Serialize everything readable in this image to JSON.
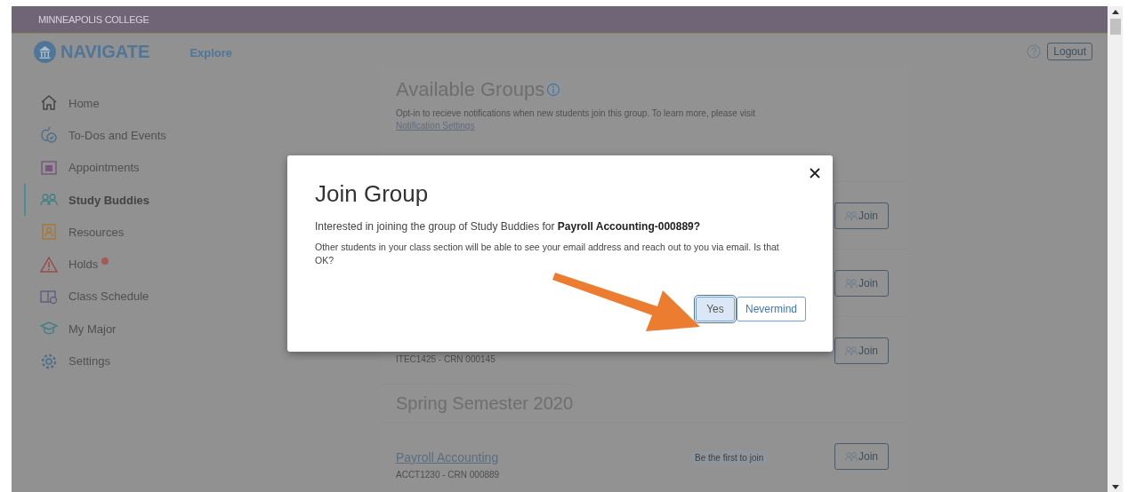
{
  "top_bar": {
    "college": "MINNEAPOLIS COLLEGE"
  },
  "header": {
    "brand": "NAVIGATE",
    "nav": [
      "Explore"
    ],
    "logout": "Logout"
  },
  "sidebar": {
    "items": [
      {
        "label": "Home",
        "selected": false,
        "alert": false
      },
      {
        "label": "To-Dos and Events",
        "selected": false,
        "alert": false
      },
      {
        "label": "Appointments",
        "selected": false,
        "alert": false
      },
      {
        "label": "Study Buddies",
        "selected": true,
        "alert": false
      },
      {
        "label": "Resources",
        "selected": false,
        "alert": false
      },
      {
        "label": "Holds",
        "selected": false,
        "alert": true
      },
      {
        "label": "Class Schedule",
        "selected": false,
        "alert": false
      },
      {
        "label": "My Major",
        "selected": false,
        "alert": false
      },
      {
        "label": "Settings",
        "selected": false,
        "alert": false
      }
    ]
  },
  "main": {
    "title": "Available Groups",
    "description": "Opt-in to recieve notifications when new students join this group. To learn more, please visit",
    "settings_link": "Notification Settings",
    "sections": [
      {
        "groups": [
          {
            "join": "Join"
          },
          {
            "join": "Join"
          },
          {
            "code": "ITEC1425 - CRN 000145",
            "join": "Join"
          }
        ]
      },
      {
        "heading": "Spring Semester 2020",
        "groups": [
          {
            "title": "Payroll Accounting",
            "code": "ACCT1230 - CRN 000889",
            "badge": "Be the first to join",
            "join": "Join"
          }
        ]
      }
    ]
  },
  "dialog": {
    "title": "Join Group",
    "question": "Interested in joining the group of Study Buddies for **Payroll Accounting-000889?**",
    "note": "Other students in your class section will be able to see your email address and reach out to you via email. Is that OK?",
    "buttons": [
      {
        "label": "Yes",
        "focused": true
      },
      {
        "label": "Nevermind",
        "focused": false
      }
    ]
  }
}
